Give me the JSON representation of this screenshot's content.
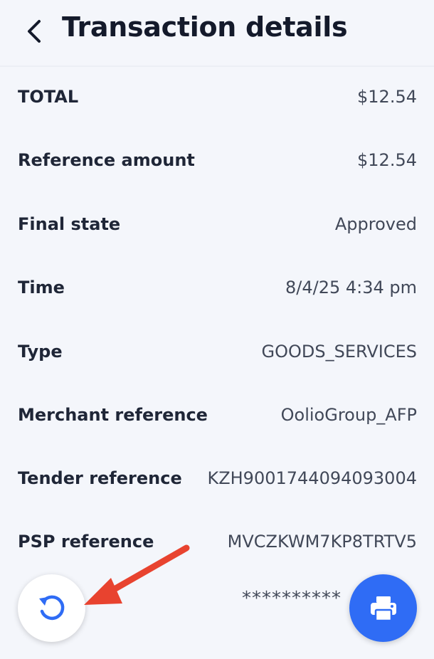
{
  "header": {
    "title": "Transaction details",
    "back_icon": "chevron-left-icon"
  },
  "details": [
    {
      "label": "TOTAL",
      "value": "$12.54"
    },
    {
      "label": "Reference amount",
      "value": "$12.54"
    },
    {
      "label": "Final state",
      "value": "Approved"
    },
    {
      "label": "Time",
      "value": "8/4/25 4:34 pm"
    },
    {
      "label": "Type",
      "value": "GOODS_SERVICES"
    },
    {
      "label": "Merchant reference",
      "value": "OolioGroup_AFP"
    },
    {
      "label": "Tender reference",
      "value": "KZH9001744094093004"
    },
    {
      "label": "PSP reference",
      "value": "MVCZKWM7KP8TRTV5"
    }
  ],
  "partial_row": {
    "value": "**********"
  },
  "actions": {
    "refresh_icon": "refresh-icon",
    "print_icon": "printer-icon"
  },
  "annotation": {
    "color": "#e8432f",
    "icon": "red-arrow-annotation"
  },
  "colors": {
    "accent": "#2f6cf5",
    "background": "#f4f6fb"
  }
}
